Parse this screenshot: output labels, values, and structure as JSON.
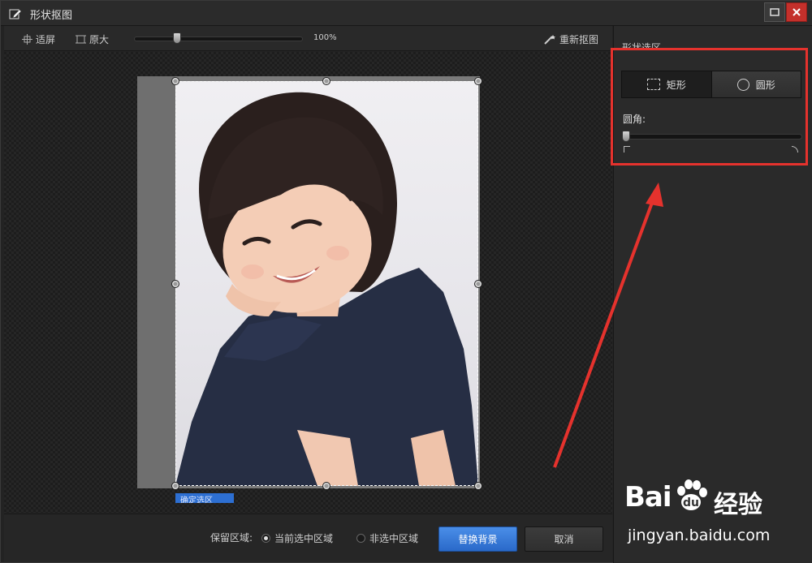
{
  "window": {
    "title": "形状抠图",
    "max_icon": "maximize-icon",
    "close_icon": "close-icon"
  },
  "toolbar": {
    "fit_label": "适屏",
    "original_label": "原大",
    "zoom_percent": "100%",
    "zoom_value": 0.25,
    "redo_label": "重新抠图"
  },
  "canvas": {
    "selection_tag": "确定选区"
  },
  "panel": {
    "title": "形状选区",
    "shape_rect": "矩形",
    "shape_circle": "圆形",
    "corner_label": "圆角:",
    "corner_value": 0
  },
  "bottom": {
    "keep_label": "保留区域:",
    "option_current": "当前选中区域",
    "option_other": "非选中区域",
    "replace_bg": "替换背景",
    "cancel": "取消"
  },
  "watermark": {
    "brand": "Bai",
    "brand_cn": "经验",
    "url": "jingyan.baidu.com"
  },
  "colors": {
    "accent": "#2a69c9",
    "annotation_red": "#e5322d",
    "close_red": "#c4302b"
  }
}
